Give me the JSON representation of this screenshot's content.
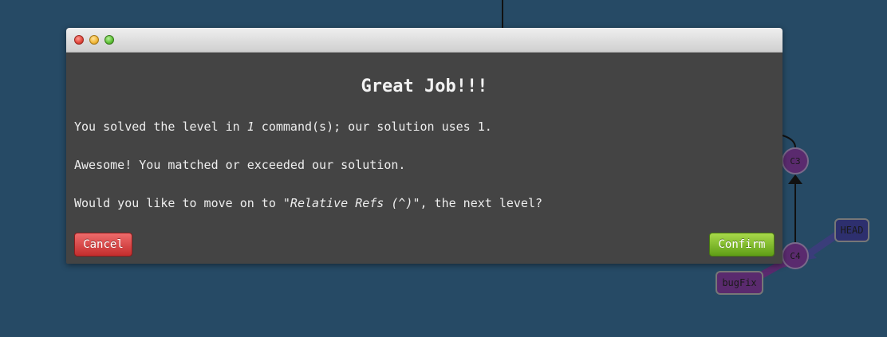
{
  "background_color": "#264a65",
  "git_tree": {
    "commits": [
      {
        "id": "C3",
        "color": "#5a2a6e"
      },
      {
        "id": "C4",
        "color": "#5a2a6e"
      }
    ],
    "refs": {
      "head": {
        "label": "HEAD",
        "color": "#2d2f6e"
      },
      "branch": {
        "label": "bugFix",
        "color": "#5a2a6e"
      }
    }
  },
  "dialog": {
    "title": "Great Job!!!",
    "line1": {
      "before": "You solved the level in ",
      "count": "1",
      "after": " command(s); our solution uses 1."
    },
    "line2": "Awesome! You matched or exceeded our solution.",
    "line3": {
      "before": "Would you like to move on to ",
      "level": "\"Relative Refs (^)\"",
      "after": ", the next level?"
    },
    "cancel_label": "Cancel",
    "confirm_label": "Confirm",
    "colors": {
      "body": "#444444",
      "cancel": "#d23a3a",
      "confirm": "#7ab32b"
    }
  }
}
